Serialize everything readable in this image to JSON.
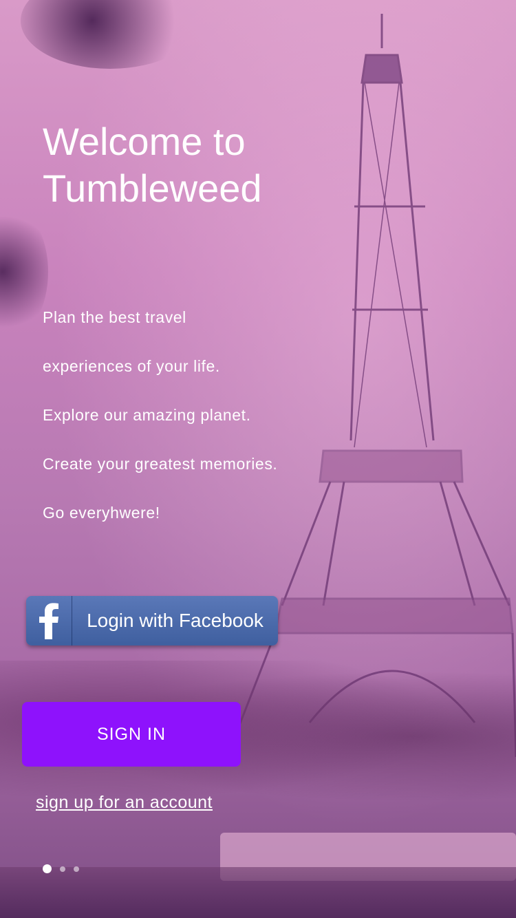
{
  "welcome": {
    "title_line1": "Welcome to",
    "title_line2": "Tumbleweed"
  },
  "tagline": [
    "Plan the best travel",
    "experiences of your life.",
    "Explore our amazing planet.",
    "Create your greatest memories.",
    "Go everyhwere!"
  ],
  "facebook_button": {
    "label": "Login with Facebook",
    "icon": "facebook-icon",
    "color": "#4a6aab"
  },
  "signin_button": {
    "label": "SIGN IN",
    "color": "#8e12fc"
  },
  "signup_link": {
    "label": "sign up for an account"
  },
  "pager": {
    "pages": 3,
    "active": 1
  },
  "background": {
    "scene": "eiffel-tower-photo",
    "tint": "#c77fbf"
  }
}
